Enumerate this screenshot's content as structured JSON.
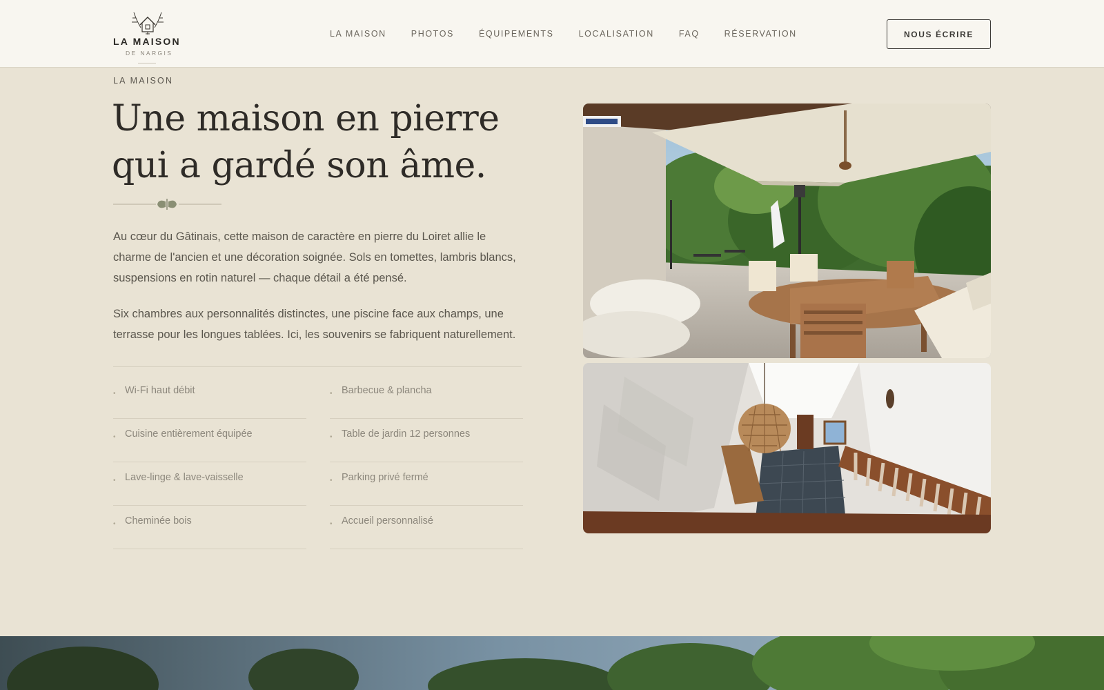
{
  "header": {
    "logo": {
      "title": "LA MAISON",
      "subtitle": "DE NARGIS"
    },
    "nav": [
      {
        "label": "LA MAISON"
      },
      {
        "label": "PHOTOS"
      },
      {
        "label": "ÉQUIPEMENTS"
      },
      {
        "label": "LOCALISATION"
      },
      {
        "label": "FAQ"
      },
      {
        "label": "RÉSERVATION"
      }
    ],
    "cta_label": "NOUS ÉCRIRE"
  },
  "section": {
    "eyebrow": "LA MAISON",
    "headline_line1": "Une maison en pierre",
    "headline_line2": "qui a gardé son âme.",
    "paragraph1": "Au cœur du Gâtinais, cette maison de caractère en pierre du Loiret allie le charme de l'ancien et une décoration soignée. Sols en tomettes, lambris blancs, suspensions en rotin naturel — chaque détail a été pensé.",
    "paragraph2": "Six chambres aux personnalités distinctes, une piscine face aux champs, une terrasse pour les longues tablées. Ici, les souvenirs se fabriquent naturellement.",
    "features_left": [
      "Wi-Fi haut débit",
      "Cuisine entièrement équipée",
      "Lave-linge & lave-vaisselle",
      "Cheminée bois"
    ],
    "features_right": [
      "Barbecue & plancha",
      "Table de jardin 12 personnes",
      "Parking privé fermé",
      "Accueil personnalisé"
    ],
    "bullet": "•"
  },
  "colors": {
    "background": "#e9e3d4",
    "header_bg": "#f8f6f0",
    "text_dark": "#2e2b27",
    "text_muted": "#8c877c",
    "accent_sage": "#8a8f74"
  }
}
